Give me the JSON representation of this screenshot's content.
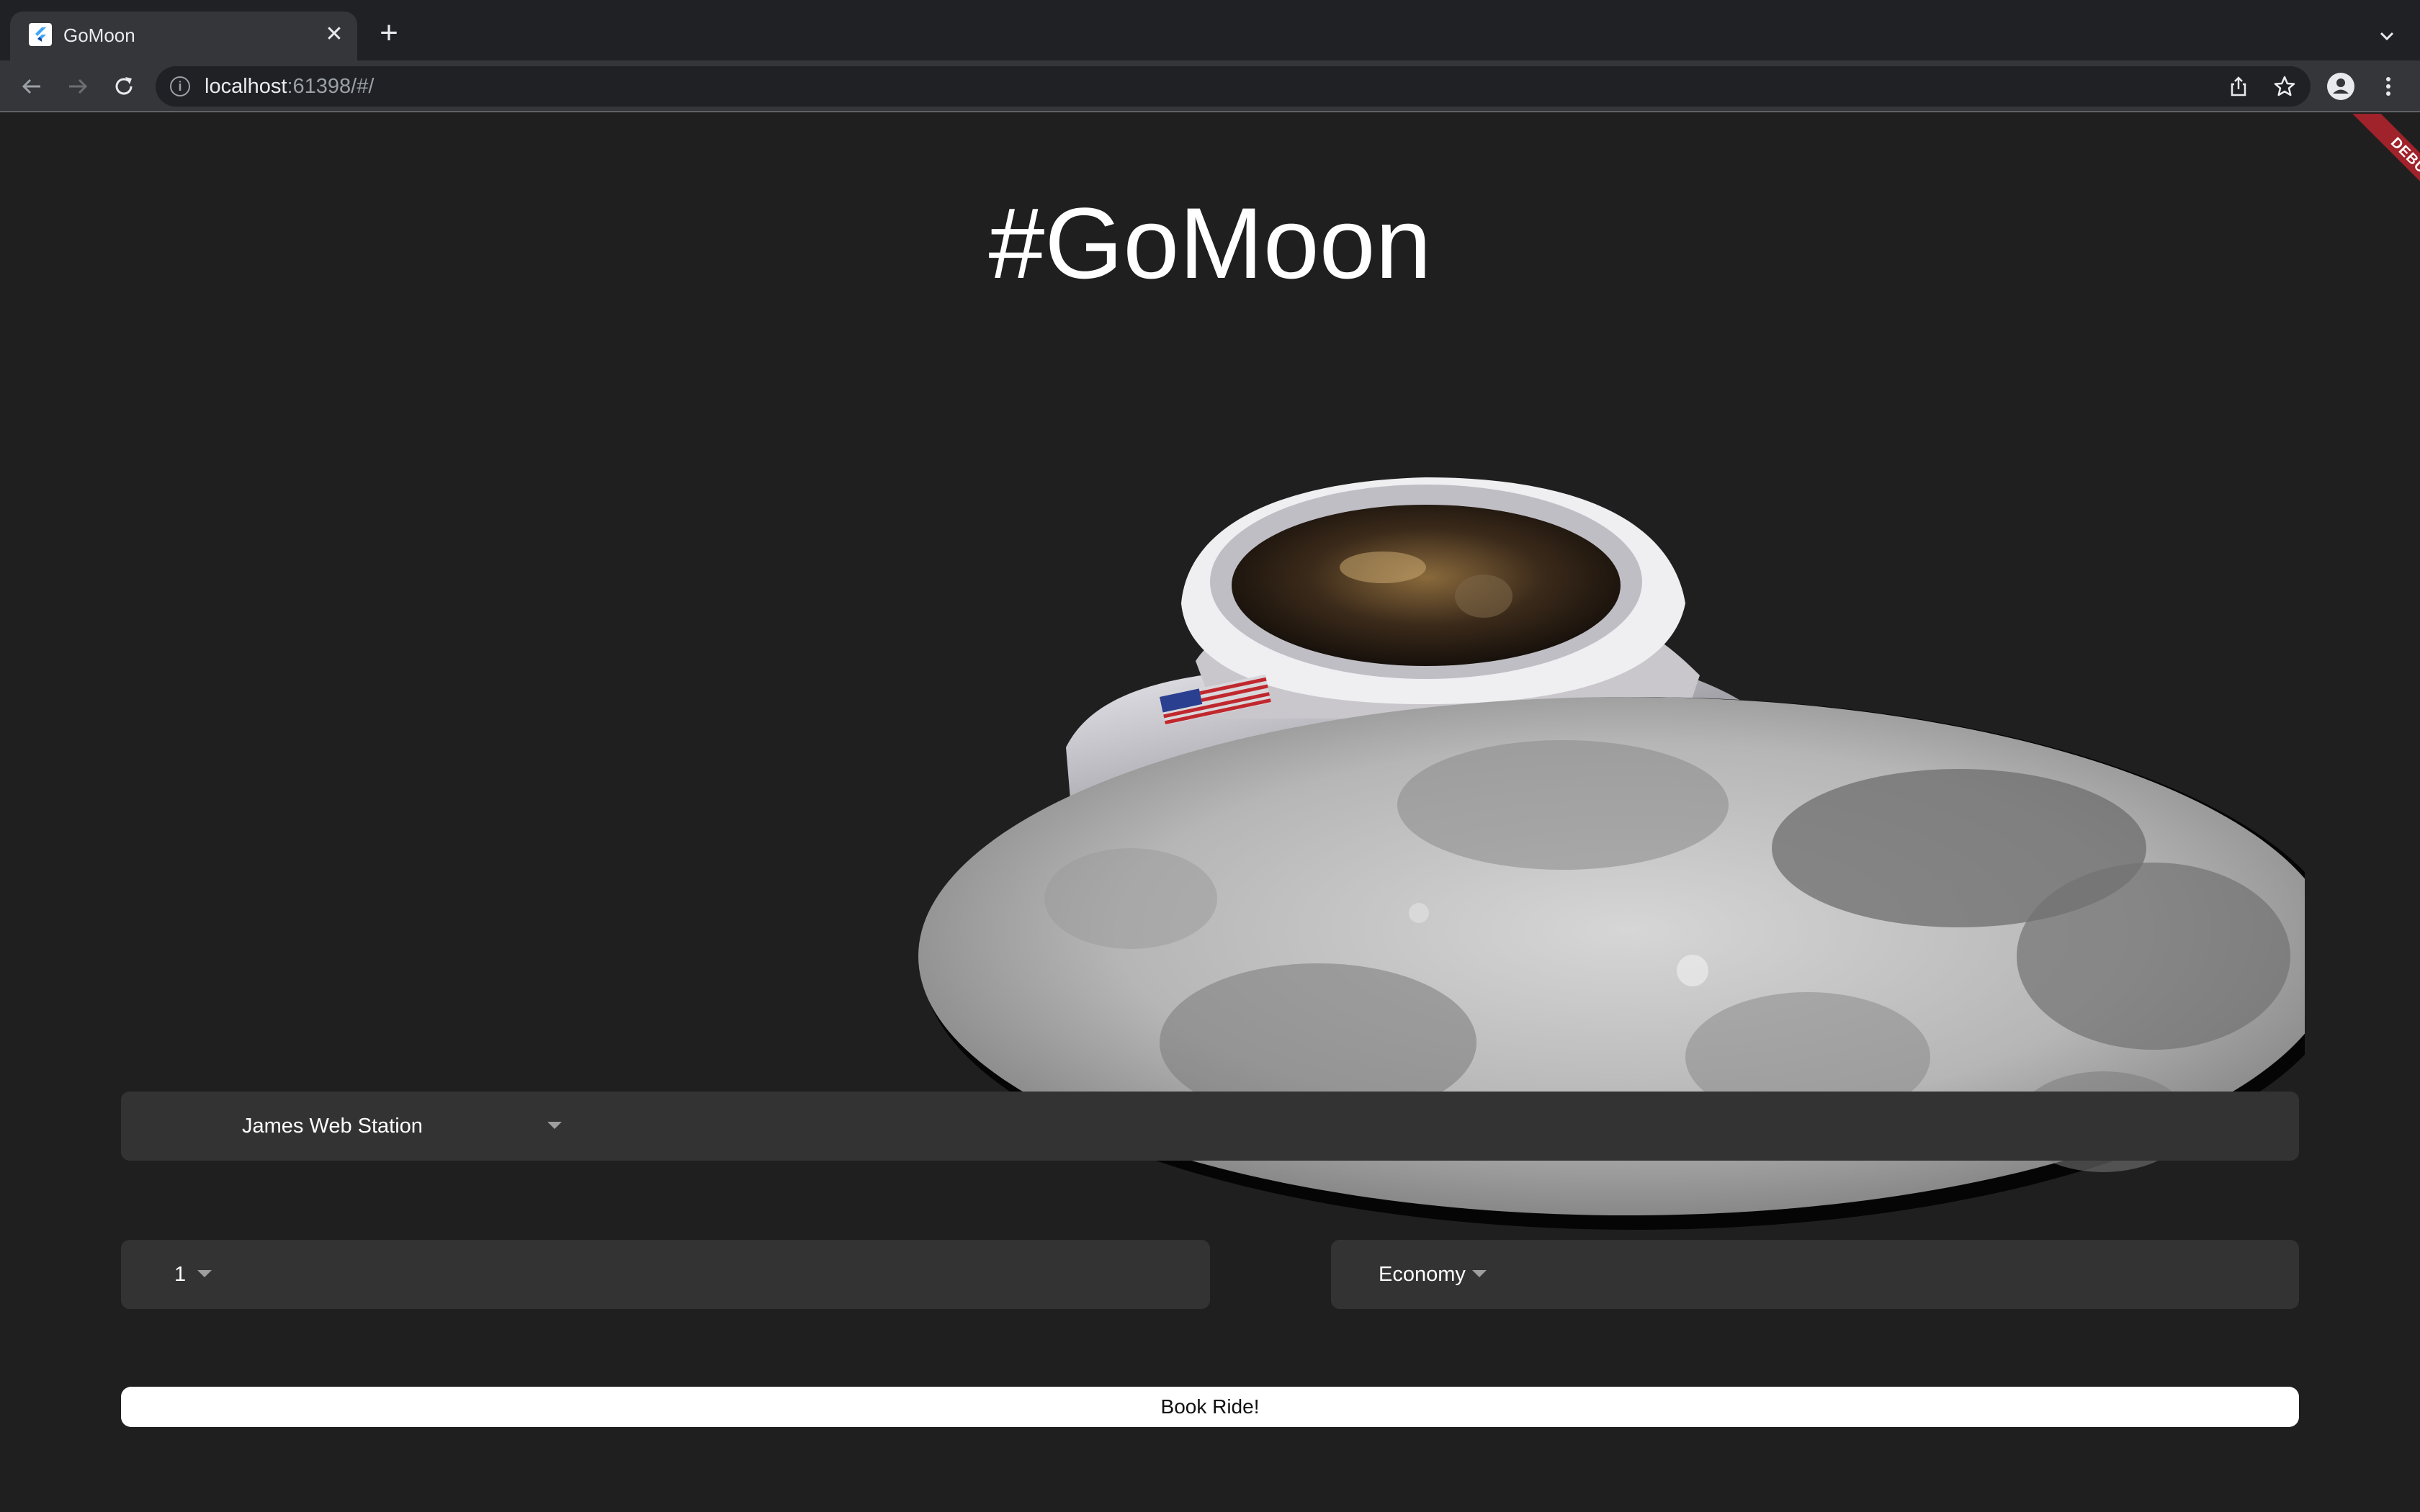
{
  "browser": {
    "tab_title": "GoMoon",
    "tab_close": "✕",
    "new_tab": "+",
    "url_host": "localhost",
    "url_rest": ":61398/#/"
  },
  "page": {
    "debug_banner": "DEBUG",
    "title": "#GoMoon",
    "destination": {
      "selected": "James Web Station"
    },
    "travellers": {
      "selected": "1"
    },
    "travel_class": {
      "selected": "Economy"
    },
    "book_button": "Book Ride!"
  },
  "colors": {
    "page_bg": "#1f1f1f",
    "field_bg": "#333333",
    "button_bg": "#ffffff",
    "debug_banner": "#a0222a"
  },
  "icons": {
    "back": "arrow-left-icon",
    "forward": "arrow-right-icon",
    "reload": "reload-icon",
    "info": "info-icon",
    "share": "share-icon",
    "bookmark": "star-icon",
    "profile": "profile-icon",
    "menu": "kebab-menu-icon",
    "tab_list": "chevron-down-icon",
    "favicon": "flutter-logo-icon"
  }
}
